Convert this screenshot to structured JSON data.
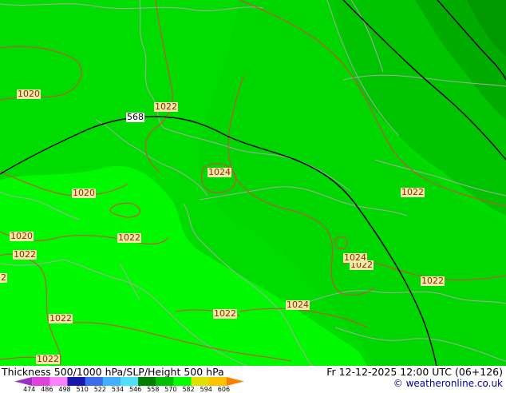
{
  "map": {
    "pressure_labels": [
      "1020",
      "1022",
      "1024",
      "1020",
      "1022",
      "1020",
      "1022",
      "1022",
      "1022",
      "1024",
      "1022",
      "1024",
      "1022",
      "2",
      "1022",
      "1022",
      "1024"
    ],
    "height_labels": [
      "568"
    ]
  },
  "footer": {
    "title": "Thickness 500/1000 hPa/SLP/Height 500 hPa",
    "valid_time": "Fr 12-12-2025 12:00 UTC (06+126)",
    "credit": "© weatheronline.co.uk"
  },
  "legend": {
    "ticks": [
      "474",
      "486",
      "498",
      "510",
      "522",
      "534",
      "546",
      "558",
      "570",
      "582",
      "594",
      "606"
    ],
    "colors": [
      "#9b30c8",
      "#e040e0",
      "#ff80ff",
      "#1818b0",
      "#3a6cf0",
      "#40b0ff",
      "#50e0ff",
      "#008000",
      "#00c000",
      "#00ff00",
      "#e0e000",
      "#ffc000",
      "#ff8000"
    ]
  },
  "colors": {
    "field_light": "#00ff00",
    "field_mid": "#00e000",
    "field_dark": "#00c000",
    "field_darker": "#00a800",
    "isobar": "#e04040",
    "border": "#a8a8a8",
    "height_contour": "#000000"
  }
}
